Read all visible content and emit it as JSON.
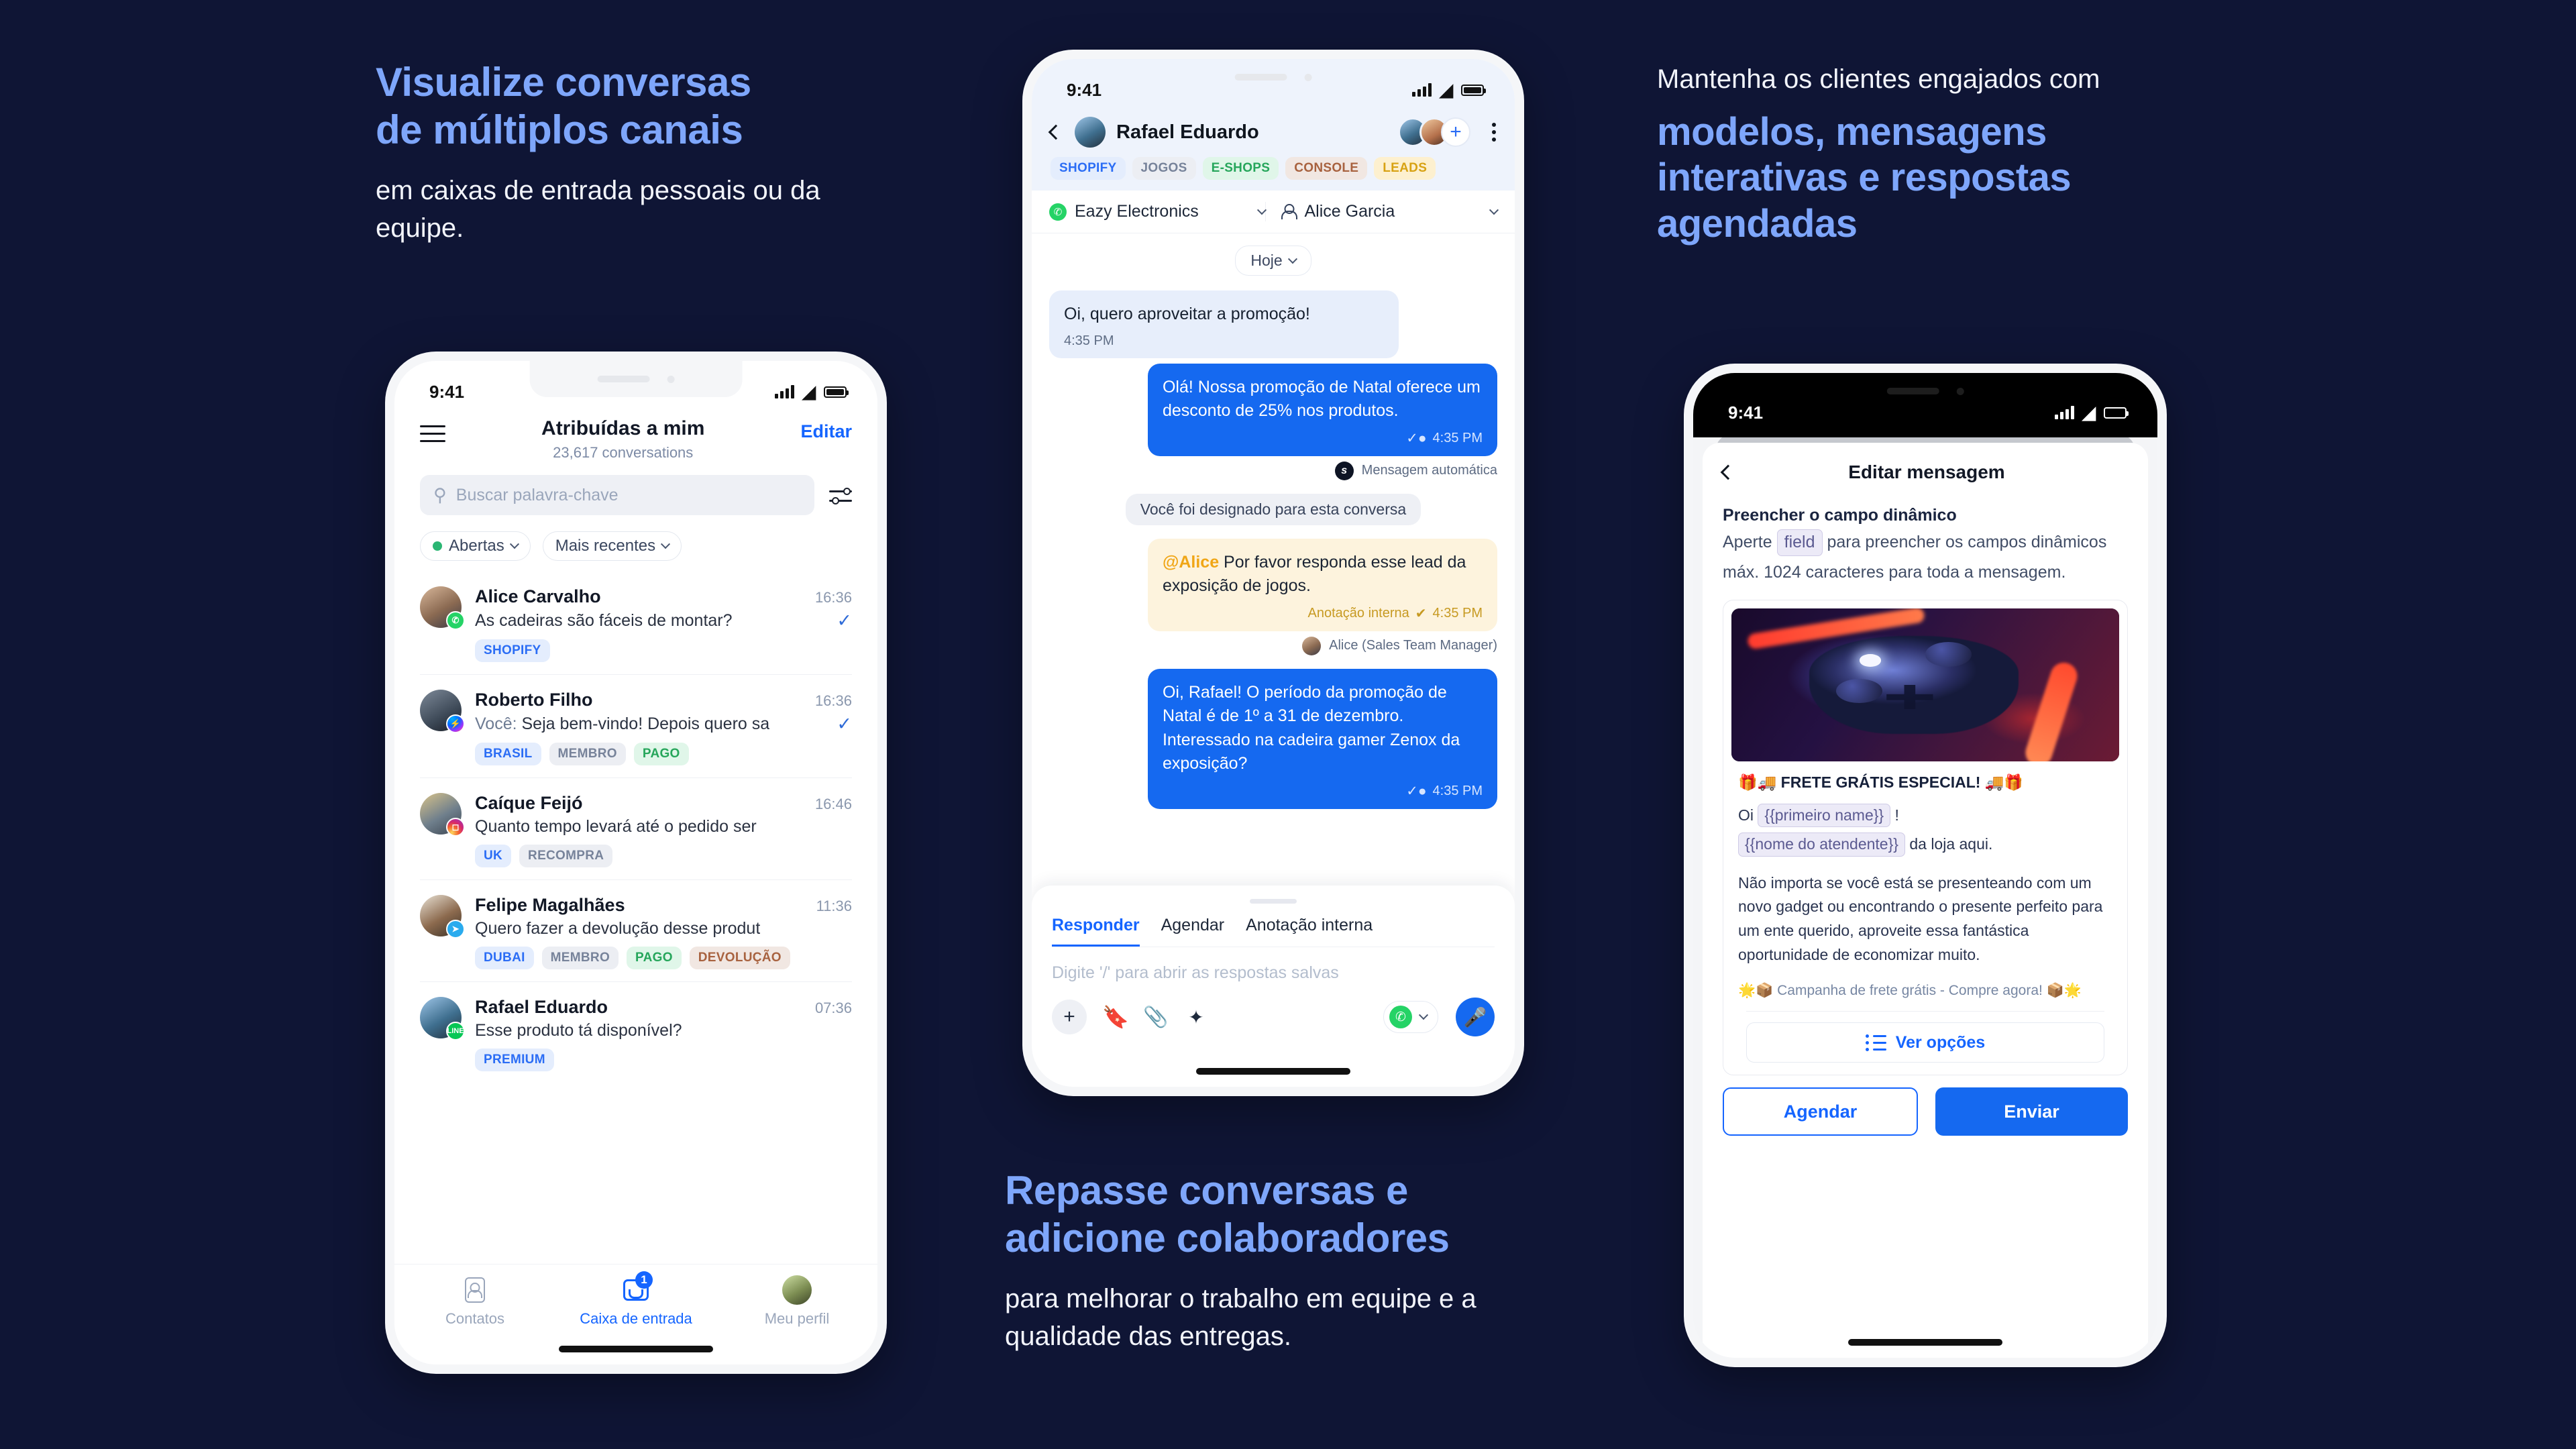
{
  "theme": {
    "bg": "#0f1535",
    "accent_blue": "#7ea6fb",
    "brand_blue": "#1565ff"
  },
  "copy": {
    "left": {
      "head_line1": "Visualize conversas",
      "head_line2": "de múltiplos canais",
      "sub": "em caixas de entrada pessoais ou da equipe."
    },
    "middle": {
      "head_line1": "Repasse conversas e",
      "head_line2": "adicione colaboradores",
      "sub": "para melhorar o trabalho em equipe e a qualidade das entregas."
    },
    "right": {
      "lead": "Mantenha os clientes engajados com",
      "head_line1": "modelos, mensagens",
      "head_line2": "interativas e respostas",
      "head_line3": "agendadas"
    }
  },
  "phone_inbox": {
    "status": {
      "time": "9:41"
    },
    "header": {
      "title": "Atribuídas a mim",
      "count": "23,617 conversations",
      "edit": "Editar"
    },
    "search": {
      "placeholder": "Buscar palavra-chave"
    },
    "filters": [
      {
        "label": "Abertas",
        "has_dot": true
      },
      {
        "label": "Mais recentes",
        "has_dot": false
      }
    ],
    "conversations": [
      {
        "name": "Alice Carvalho",
        "time": "16:36",
        "message": "As cadeiras são fáceis de montar?",
        "prefix": "",
        "channel": "whatsapp",
        "read": true,
        "avatar": "ph-a",
        "tags": [
          {
            "label": "SHOPIFY",
            "style": "t-blue"
          }
        ]
      },
      {
        "name": "Roberto Filho",
        "time": "16:36",
        "message": "Seja bem-vindo! Depois quero sa",
        "prefix": "Você: ",
        "channel": "messenger",
        "read": true,
        "avatar": "ph-b",
        "tags": [
          {
            "label": "BRASIL",
            "style": "t-blue"
          },
          {
            "label": "MEMBRO",
            "style": "t-grey"
          },
          {
            "label": "PAGO",
            "style": "t-green"
          }
        ]
      },
      {
        "name": "Caíque Feijó",
        "time": "16:46",
        "message": "Quanto tempo levará até o pedido ser",
        "prefix": "",
        "channel": "instagram",
        "read": false,
        "avatar": "ph-c",
        "tags": [
          {
            "label": "UK",
            "style": "t-blue"
          },
          {
            "label": "RECOMPRA",
            "style": "t-grey"
          }
        ]
      },
      {
        "name": "Felipe Magalhães",
        "time": "11:36",
        "message": "Quero fazer a devolução desse produt",
        "prefix": "",
        "channel": "telegram",
        "read": false,
        "avatar": "ph-d",
        "tags": [
          {
            "label": "DUBAI",
            "style": "t-blue"
          },
          {
            "label": "MEMBRO",
            "style": "t-grey"
          },
          {
            "label": "PAGO",
            "style": "t-green"
          },
          {
            "label": "DEVOLUÇÃO",
            "style": "t-brown"
          }
        ]
      },
      {
        "name": "Rafael Eduardo",
        "time": "07:36",
        "message": "Esse produto tá disponível?",
        "prefix": "",
        "channel": "line",
        "read": false,
        "avatar": "ph-e",
        "tags": [
          {
            "label": "PREMIUM",
            "style": "t-blue"
          }
        ]
      }
    ],
    "tabs": [
      {
        "label": "Contatos",
        "active": false,
        "badge": ""
      },
      {
        "label": "Caixa de entrada",
        "active": true,
        "badge": "1"
      },
      {
        "label": "Meu perfil",
        "active": false,
        "badge": ""
      }
    ]
  },
  "phone_chat": {
    "status": {
      "time": "9:41"
    },
    "header": {
      "contact": "Rafael Eduardo"
    },
    "tags": [
      {
        "label": "SHOPIFY",
        "style": "t-blue"
      },
      {
        "label": "JOGOS",
        "style": "t-grey"
      },
      {
        "label": "E-SHOPS",
        "style": "t-green"
      },
      {
        "label": "CONSOLE",
        "style": "t-brown"
      },
      {
        "label": "LEADS",
        "style": "t-yellow"
      }
    ],
    "selectors": {
      "channel": "Eazy Electronics",
      "agent": "Alice Garcia"
    },
    "day_chip": "Hoje",
    "messages": [
      {
        "kind": "in",
        "text": "Oi, quero aproveitar a promoção!",
        "time": "4:35 PM"
      },
      {
        "kind": "out",
        "text": "Olá! Nossa promoção de Natal oferece um desconto de 25% nos produtos.",
        "time": "4:35 PM",
        "footer": "Mensagem automática"
      },
      {
        "kind": "system",
        "text": "Você foi designado para esta conversa"
      },
      {
        "kind": "note",
        "mention": "@Alice",
        "text": " Por favor responda esse lead da exposição de jogos.",
        "meta": "Anotação interna",
        "time": "4:35 PM",
        "footer": "Alice (Sales Team Manager)"
      },
      {
        "kind": "out",
        "text": "Oi, Rafael! O período da promoção de Natal é de 1º a 31 de dezembro. Interessado na cadeira gamer Zenox da exposição?",
        "time": "4:35 PM"
      }
    ],
    "composer": {
      "tabs": [
        {
          "label": "Responder",
          "active": true
        },
        {
          "label": "Agendar",
          "active": false
        },
        {
          "label": "Anotação interna",
          "active": false
        }
      ],
      "placeholder": "Digite '/' para abrir as respostas salvas",
      "channel_picker": "whatsapp"
    }
  },
  "phone_template": {
    "status": {
      "time": "9:41"
    },
    "header": {
      "title": "Editar mensagem"
    },
    "instructions": {
      "title": "Preencher o campo dinâmico",
      "line_before": "Aperte",
      "pill": "field",
      "line_after": "para preencher os campos dinâmicos",
      "line2": "máx. 1024 caracteres para toda a mensagem."
    },
    "preview": {
      "title": "🎁🚚 FRETE GRÁTIS ESPECIAL! 🚚🎁",
      "greet_before": "Oi",
      "greet_var": "{{primeiro name}}",
      "greet_after": "!",
      "signer_var": "{{nome do atendente}}",
      "signer_after": "da loja aqui.",
      "body": "Não importa se você está se presenteando com um novo gadget ou encontrando o presente perfeito para um ente querido, aproveite essa fantástica oportunidade de economizar muito.",
      "footer": "🌟📦 Campanha de frete grátis - Compre agora! 📦🌟",
      "options_button": "Ver opções"
    },
    "actions": {
      "schedule": "Agendar",
      "send": "Enviar"
    }
  }
}
